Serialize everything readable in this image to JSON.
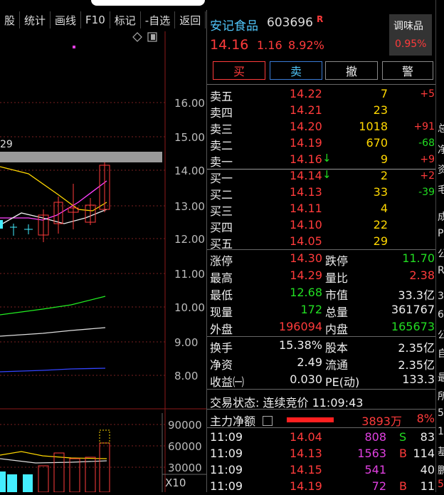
{
  "toolbar": {
    "items": [
      "股",
      "统计",
      "画线",
      "F10",
      "标记",
      "-自选",
      "返回"
    ]
  },
  "chart": {
    "fragment_label": "29",
    "price_axis": [
      "16.00",
      "15.00",
      "14.00",
      "13.00",
      "12.00",
      "11.00",
      "10.00",
      "9.00",
      "8.00"
    ],
    "volume_axis": [
      "90000",
      "60000",
      "30000"
    ],
    "volume_unit": "X10"
  },
  "stock": {
    "name": "安记食品",
    "code": "603696",
    "badge": "R",
    "price": "14.16",
    "change": "1.16",
    "pct": "8.92%",
    "sector_name": "调味品",
    "sector_pct": "0.95%"
  },
  "actions": {
    "buy": "买",
    "sell": "卖",
    "cancel": "撤",
    "alert": "警"
  },
  "asks": [
    {
      "label": "卖五",
      "price": "14.22",
      "vol": "7",
      "chg": "+5"
    },
    {
      "label": "卖四",
      "price": "14.21",
      "vol": "23",
      "chg": ""
    },
    {
      "label": "卖三",
      "price": "14.20",
      "vol": "1018",
      "chg": "+91"
    },
    {
      "label": "卖二",
      "price": "14.19",
      "vol": "670",
      "chg": "-68"
    },
    {
      "label": "卖一",
      "price": "14.16",
      "vol": "9",
      "chg": "+9"
    }
  ],
  "bids": [
    {
      "label": "买一",
      "price": "14.14",
      "vol": "2",
      "chg": "+2"
    },
    {
      "label": "买二",
      "price": "14.13",
      "vol": "33",
      "chg": "-39"
    },
    {
      "label": "买三",
      "price": "14.11",
      "vol": "4",
      "chg": ""
    },
    {
      "label": "买四",
      "price": "14.10",
      "vol": "22",
      "chg": ""
    },
    {
      "label": "买五",
      "price": "14.05",
      "vol": "29",
      "chg": ""
    }
  ],
  "stats": [
    {
      "l1": "涨停",
      "v1": "14.30",
      "l2": "跌停",
      "v2": "11.70"
    },
    {
      "l1": "最高",
      "v1": "14.29",
      "l2": "量比",
      "v2": "2.38"
    },
    {
      "l1": "最低",
      "v1": "12.68",
      "l2": "市值",
      "v2": "33.3亿"
    },
    {
      "l1": "现量",
      "v1": "172",
      "l2": "总量",
      "v2": "361767"
    },
    {
      "l1": "外盘",
      "v1": "196094",
      "l2": "内盘",
      "v2": "165673"
    }
  ],
  "stats2": [
    {
      "l1": "换手",
      "v1": "15.38%",
      "l2": "股本",
      "v2": "2.35亿"
    },
    {
      "l1": "净资",
      "v1": "2.49",
      "l2": "流通",
      "v2": "2.35亿"
    },
    {
      "l1": "收益㈠",
      "v1": "0.030",
      "l2": "PE(动)",
      "v2": "133.3"
    }
  ],
  "trade_status": "交易状态: 连续竞价 11:09:43",
  "main_flow": {
    "label": "主力净额",
    "value": "3893万",
    "pct": "8%"
  },
  "ticks": [
    {
      "time": "11:09",
      "price": "14.04",
      "vol": "808",
      "side": "S",
      "n": "83"
    },
    {
      "time": "11:09",
      "price": "14.13",
      "vol": "1563",
      "side": "B",
      "n": "114"
    },
    {
      "time": "11:09",
      "price": "14.15",
      "vol": "541",
      "side": "",
      "n": "40"
    },
    {
      "time": "11:09",
      "price": "14.19",
      "vol": "72",
      "side": "B",
      "n": "11"
    }
  ],
  "edge_chars": [
    "总",
    "净",
    "资",
    "毛",
    "成",
    "P",
    "公",
    "R",
    "3",
    "6",
    "公",
    "自",
    "最",
    "所",
    "5",
    "1",
    "基",
    "鹏",
    "5"
  ],
  "colors": {
    "up": "#ff3b3b",
    "down": "#22dd22",
    "vol": "#ffd700"
  }
}
